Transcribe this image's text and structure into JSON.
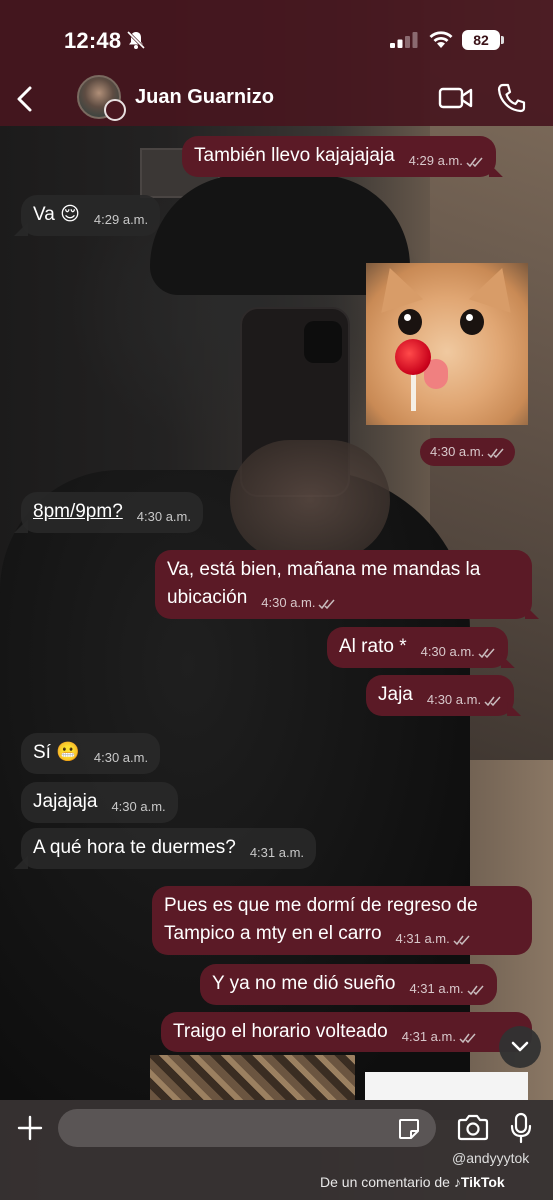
{
  "status_bar": {
    "time": "12:48",
    "battery": "82",
    "icons": [
      "bell-slash-icon",
      "signal-icon",
      "wifi-icon",
      "battery-icon"
    ]
  },
  "header": {
    "contact_name": "Juan Guarnizo",
    "icons": [
      "back-icon",
      "avatar",
      "video-call-icon",
      "voice-call-icon"
    ]
  },
  "messages": [
    {
      "dir": "out",
      "text": "También llevo kajajajaja",
      "time": "4:29 a.m.",
      "read": true
    },
    {
      "dir": "in",
      "text": "Va 😌",
      "time": "4:29 a.m."
    },
    {
      "dir": "out",
      "type": "sticker",
      "sticker": "cat-lollipop-sticker",
      "time": "4:30 a.m.",
      "read": true
    },
    {
      "dir": "in",
      "text": "8pm/9pm?",
      "time": "4:30 a.m."
    },
    {
      "dir": "out",
      "text": "Va, está bien, mañana me mandas la ubicación",
      "time": "4:30 a.m.",
      "read": true
    },
    {
      "dir": "out",
      "text": "Al rato *",
      "time": "4:30 a.m.",
      "read": true
    },
    {
      "dir": "out",
      "text": "Jaja",
      "time": "4:30 a.m.",
      "read": true
    },
    {
      "dir": "in",
      "text": "Sí 😬",
      "time": "4:30 a.m."
    },
    {
      "dir": "in",
      "text": "Jajajaja",
      "time": "4:30 a.m."
    },
    {
      "dir": "in",
      "text": "A qué hora te duermes?",
      "time": "4:31 a.m."
    },
    {
      "dir": "out",
      "text": "Pues es que me dormí de regreso de Tampico a mty en el carro",
      "time": "4:31 a.m.",
      "read": true
    },
    {
      "dir": "out",
      "text": "Y ya no me dió sueño",
      "time": "4:31 a.m.",
      "read": true
    },
    {
      "dir": "out",
      "text": "Traigo el horario volteado",
      "time": "4:31 a.m.",
      "read": true
    }
  ],
  "input": {
    "value": "",
    "placeholder": ""
  },
  "footer": {
    "tiktok_user": "@andyyytok",
    "caption_prefix": "De un comentario de",
    "caption_brand": "TikTok"
  },
  "colors": {
    "outgoing_bubble": "#5b1a26",
    "incoming_bubble": "#282828",
    "header_bg": "#46161e"
  }
}
